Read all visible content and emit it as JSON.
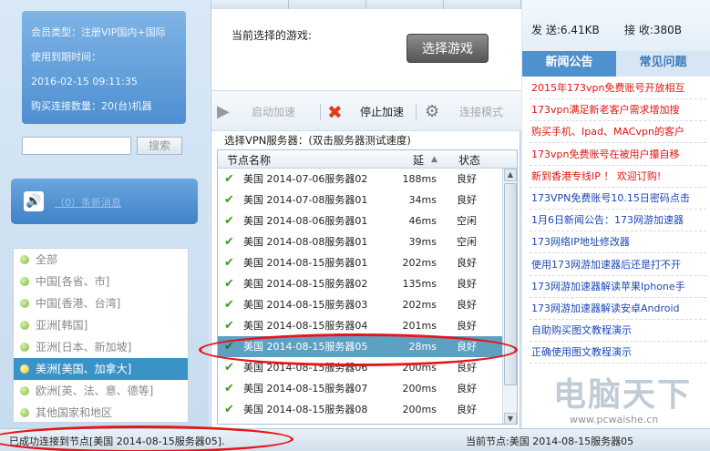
{
  "member": {
    "type": "会员类型：注册VIP国内+国际",
    "expiry_label": "使用到期时间：",
    "expiry_value": "2016-02-15 09:11:35",
    "connections": "购买连接数量：20(台)机器"
  },
  "search": {
    "button": "搜索",
    "value": ""
  },
  "messages": {
    "link": "（0）条新消息"
  },
  "regions": [
    {
      "label": "全部",
      "active": false
    },
    {
      "label": "中国[各省、市]",
      "active": false
    },
    {
      "label": "中国[香港、台湾]",
      "active": false
    },
    {
      "label": "亚洲[韩国]",
      "active": false
    },
    {
      "label": "亚洲[日本、新加坡]",
      "active": false
    },
    {
      "label": "美洲[美国、加拿大]",
      "active": true
    },
    {
      "label": "欧洲[英、法、意、德等]",
      "active": false
    },
    {
      "label": "其他国家和地区",
      "active": false
    }
  ],
  "game": {
    "current_label": "当前选择的游戏:",
    "select_button": "选择游戏"
  },
  "toolbar": {
    "start": "启动加速",
    "stop": "停止加速",
    "mode": "连接模式"
  },
  "servers": {
    "title": "选择VPN服务器：(双击服务器测试速度)",
    "columns": [
      "节点名称",
      "延",
      "状态"
    ],
    "rows": [
      {
        "name": "美国 2014-07-06服务器02",
        "ping": "188ms",
        "status": "良好",
        "selected": false
      },
      {
        "name": "美国 2014-07-08服务器01",
        "ping": "34ms",
        "status": "良好",
        "selected": false
      },
      {
        "name": "美国 2014-08-06服务器01",
        "ping": "46ms",
        "status": "空闲",
        "selected": false
      },
      {
        "name": "美国 2014-08-08服务器01",
        "ping": "39ms",
        "status": "空闲",
        "selected": false
      },
      {
        "name": "美国 2014-08-15服务器01",
        "ping": "202ms",
        "status": "良好",
        "selected": false
      },
      {
        "name": "美国 2014-08-15服务器02",
        "ping": "135ms",
        "status": "良好",
        "selected": false
      },
      {
        "name": "美国 2014-08-15服务器03",
        "ping": "202ms",
        "status": "良好",
        "selected": false
      },
      {
        "name": "美国 2014-08-15服务器04",
        "ping": "201ms",
        "status": "良好",
        "selected": false
      },
      {
        "name": "美国 2014-08-15服务器05",
        "ping": "28ms",
        "status": "良好",
        "selected": true
      },
      {
        "name": "美国 2014-08-15服务器06",
        "ping": "200ms",
        "status": "良好",
        "selected": false
      },
      {
        "name": "美国 2014-08-15服务器07",
        "ping": "200ms",
        "status": "良好",
        "selected": false
      },
      {
        "name": "美国 2014-08-15服务器08",
        "ping": "200ms",
        "status": "良好",
        "selected": false
      }
    ]
  },
  "traffic": {
    "send": "发 送:6.41KB",
    "recv": "接 收:380B"
  },
  "news_tabs": {
    "news": "新闻公告",
    "faq": "常见问题"
  },
  "news": [
    {
      "text": "2015年173vpn免费账号开放相互",
      "color": "red"
    },
    {
      "text": "173vpn满足新老客户需求增加搜",
      "color": "red"
    },
    {
      "text": "购买手机、Ipad、MACvpn的客户",
      "color": "red"
    },
    {
      "text": "173vpn免费账号在被用户攥自移",
      "color": "red"
    },
    {
      "text": "新到香港专线IP ！ 欢迎订购!",
      "color": "red"
    },
    {
      "text": "173VPN免费账号10.15日密码点击",
      "color": "blue"
    },
    {
      "text": "1月6日新闻公告：173网游加速器",
      "color": "blue"
    },
    {
      "text": "173网络IP地址修改器",
      "color": "blue"
    },
    {
      "text": "使用173网游加速器后还是打不开",
      "color": "blue"
    },
    {
      "text": "173网游加速器解读苹果Iphone手",
      "color": "blue"
    },
    {
      "text": "173网游加速器解读安卓Android",
      "color": "blue"
    },
    {
      "text": "自助购买图文教程演示",
      "color": "blue"
    },
    {
      "text": "正确使用图文教程演示",
      "color": "blue"
    }
  ],
  "watermark": {
    "text": "电脑天下",
    "url": "www.pcwaishe.cn"
  },
  "status": {
    "left": "已成功连接到节点[美国 2014-08-15服务器05].",
    "right": "当前节点:美国 2014-08-15服务器05"
  },
  "colors": {
    "selected_row": "#5da0c2",
    "active_region": "#3a93c7",
    "news_red": "#e0150d",
    "news_blue": "#1d47b6",
    "annotation": "#e8141a"
  }
}
